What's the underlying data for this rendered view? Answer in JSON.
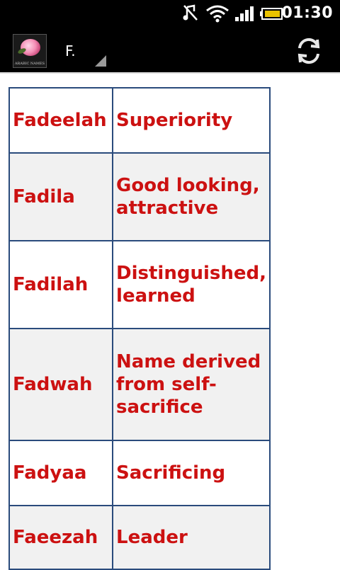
{
  "status_bar": {
    "time": "01:30",
    "icons": [
      "notification-icon",
      "wifi-icon",
      "signal-icon",
      "battery-icon"
    ]
  },
  "action_bar": {
    "app_icon": "app-logo-rose",
    "app_icon_caption": "ARABIC NAMES",
    "spinner_value": "F.",
    "refresh_icon": "refresh-icon"
  },
  "colors": {
    "text": "#cc1111",
    "border": "#2a4b7c",
    "row_alt": "#f1f1f1"
  },
  "rows": [
    {
      "name": "Fadeelah",
      "meaning": "Superiority"
    },
    {
      "name": "Fadila",
      "meaning": "Good looking, attractive"
    },
    {
      "name": "Fadilah",
      "meaning": "Distinguished, learned"
    },
    {
      "name": "Fadwah",
      "meaning": "Name derived from self-sacrifice"
    },
    {
      "name": "Fadyaa",
      "meaning": "Sacrificing"
    },
    {
      "name": "Faeezah",
      "meaning": "Leader"
    }
  ]
}
